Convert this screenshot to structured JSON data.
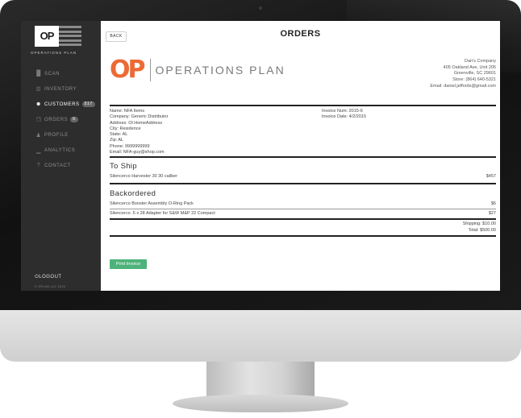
{
  "sidebar": {
    "logo_mark": "OP",
    "logo_name": "OPERATIONS PLAN",
    "items": [
      {
        "icon": "barcode-icon",
        "glyph": "█",
        "label": "SCAN",
        "badge": ""
      },
      {
        "icon": "list-icon",
        "glyph": "☰",
        "label": "INVENTORY",
        "badge": ""
      },
      {
        "icon": "users-icon",
        "glyph": "☻",
        "label": "CUSTOMERS",
        "badge": "517"
      },
      {
        "icon": "copy-icon",
        "glyph": "❐",
        "label": "ORDERS",
        "badge": "6"
      },
      {
        "icon": "user-icon",
        "glyph": "♟",
        "label": "PROFILE",
        "badge": ""
      },
      {
        "icon": "chart-icon",
        "glyph": "▁",
        "label": "ANALYTICS",
        "badge": ""
      },
      {
        "icon": "question-icon",
        "glyph": "?",
        "label": "CONTACT",
        "badge": ""
      }
    ],
    "logout_label": "LOGOUT",
    "copyright": "© OPLAN LLC 2015"
  },
  "header": {
    "back_label": "BACK",
    "title": "ORDERS"
  },
  "brand": {
    "mark": "OP",
    "name": "OPERATIONS PLAN"
  },
  "company": {
    "name": "Dan's Company",
    "street": "405 Oakland Ave, Unit 205",
    "city_state": "Greenville, SC 29601",
    "store": "Store: (864) 640-5321",
    "email": "Email: daniel.jeffords@gmail.com"
  },
  "bill_to": {
    "name": "Name: NFA Items",
    "company": "Company: Generic Distributor",
    "address": "Address: Ol HomeAddress",
    "city": "City: Residence",
    "state": "State: AL",
    "zip": "Zip: AL",
    "phone": "Phone: 9999999999",
    "email": "Email: NFA-guy@shop.com"
  },
  "invoice": {
    "number": "Invoice Num: 2015-6",
    "date": "Invoice Date: 4/2/2015"
  },
  "to_ship": {
    "title": "To Ship",
    "items": [
      {
        "name": "Silencerco Harvester 30 30 caliber",
        "price": "$457"
      }
    ]
  },
  "backordered": {
    "title": "Backordered",
    "items": [
      {
        "name": "Silencerco Booster Assembly O-Ring Pack",
        "price": "$6"
      },
      {
        "name": "Silencerco .5 x 28 Adapter for S&W M&P 22 Compact",
        "price": "$27"
      }
    ]
  },
  "totals": {
    "shipping": "Shipping: $10.00",
    "total": "Total: $500.00"
  },
  "actions": {
    "print_label": "Print Invoice"
  },
  "colors": {
    "brand_orange": "#ec6a35",
    "sidebar_bg": "#2d2d2d",
    "print_green": "#4db37a"
  }
}
